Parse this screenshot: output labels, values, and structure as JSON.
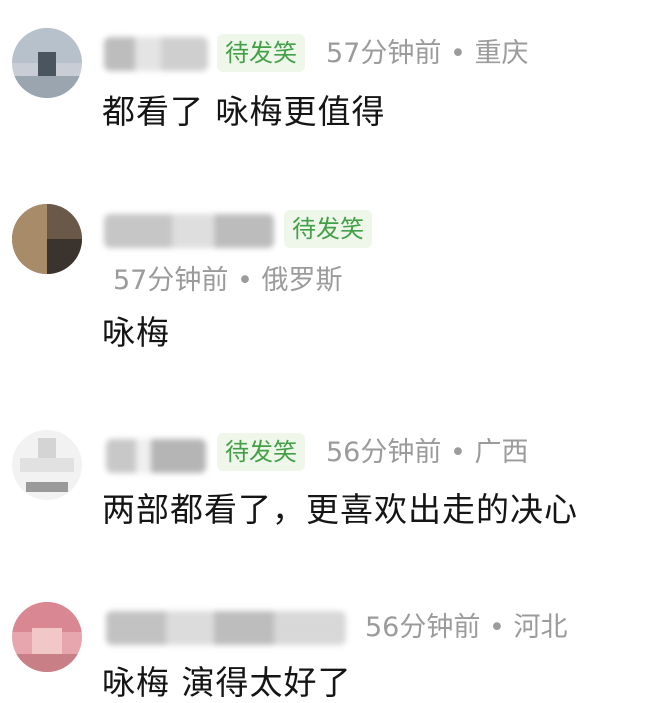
{
  "comments": [
    {
      "username": "",
      "badge": "待发笑",
      "time": "57分钟前",
      "location": "重庆",
      "text": "都看了 咏梅更值得"
    },
    {
      "username": "",
      "badge": "待发笑",
      "time": "57分钟前",
      "location": "俄罗斯",
      "text": "咏梅"
    },
    {
      "username": "",
      "badge": "待发笑",
      "time": "56分钟前",
      "location": "广西",
      "text": "两部都看了，更喜欢出走的决心"
    },
    {
      "username": "",
      "badge": "",
      "time": "56分钟前",
      "location": "河北",
      "text": "咏梅 演得太好了"
    }
  ],
  "separator": "•",
  "colors": {
    "badge_bg": "#eef7ea",
    "badge_text": "#43a047",
    "meta_text": "#9b9b9b",
    "body_text": "#151515"
  }
}
